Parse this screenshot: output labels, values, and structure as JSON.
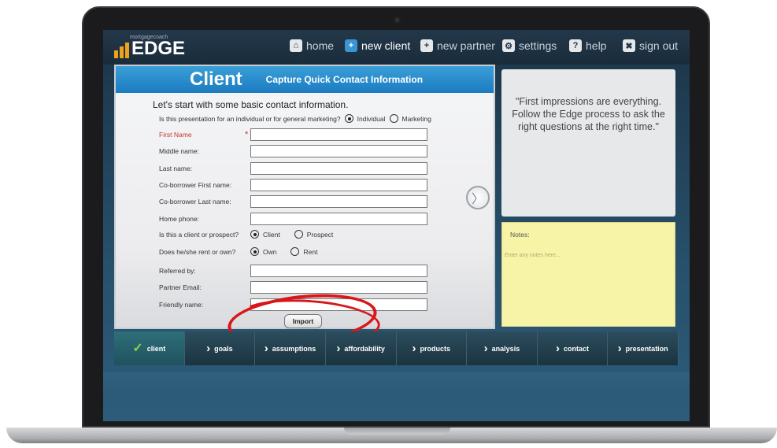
{
  "nav": {
    "logo_small": "mortgagecoach",
    "logo_text": "EDGE",
    "items": [
      {
        "label": "home",
        "icon": "home-icon"
      },
      {
        "label": "new client",
        "icon": "new-client-icon"
      },
      {
        "label": "new partner",
        "icon": "new-partner-icon"
      },
      {
        "label": "settings",
        "icon": "settings-icon"
      },
      {
        "label": "help",
        "icon": "help-icon"
      },
      {
        "label": "sign out",
        "icon": "sign-out-icon"
      }
    ]
  },
  "panel": {
    "title": "Client",
    "subtitle": "Capture Quick Contact Information",
    "intro": "Let's start with some basic contact information.",
    "question": "Is this presentation for an individual or for general marketing?",
    "q_options": [
      "Individual",
      "Marketing"
    ],
    "first_name": "First Name",
    "middle_name": "Middle name:",
    "last_name": "Last name:",
    "co_first": "Co-borrower First name:",
    "co_last": "Co-borrower Last name:",
    "home_phone": "Home phone:",
    "client_q": "Is this a client or prospect?",
    "client_opts": [
      "Client",
      "Prospect"
    ],
    "rent_q": "Does he/she rent or own?",
    "rent_opts": [
      "Own",
      "Rent"
    ],
    "referred": "Referred by:",
    "partner_email": "Partner Email:",
    "friendly": "Friendly name:",
    "import_label": "Import"
  },
  "quote": "\"First impressions are everything. Follow the Edge process to ask the right questions at the right time.\"",
  "notes": {
    "label": "Notes:",
    "placeholder": "Enter any notes here..."
  },
  "tabs": [
    "client",
    "goals",
    "assumptions",
    "affordability",
    "products",
    "analysis",
    "contact",
    "presentation"
  ],
  "colors": {
    "accent": "#1c7bc0",
    "annotation": "#d8171a",
    "notes_bg": "#f7f4a8"
  }
}
